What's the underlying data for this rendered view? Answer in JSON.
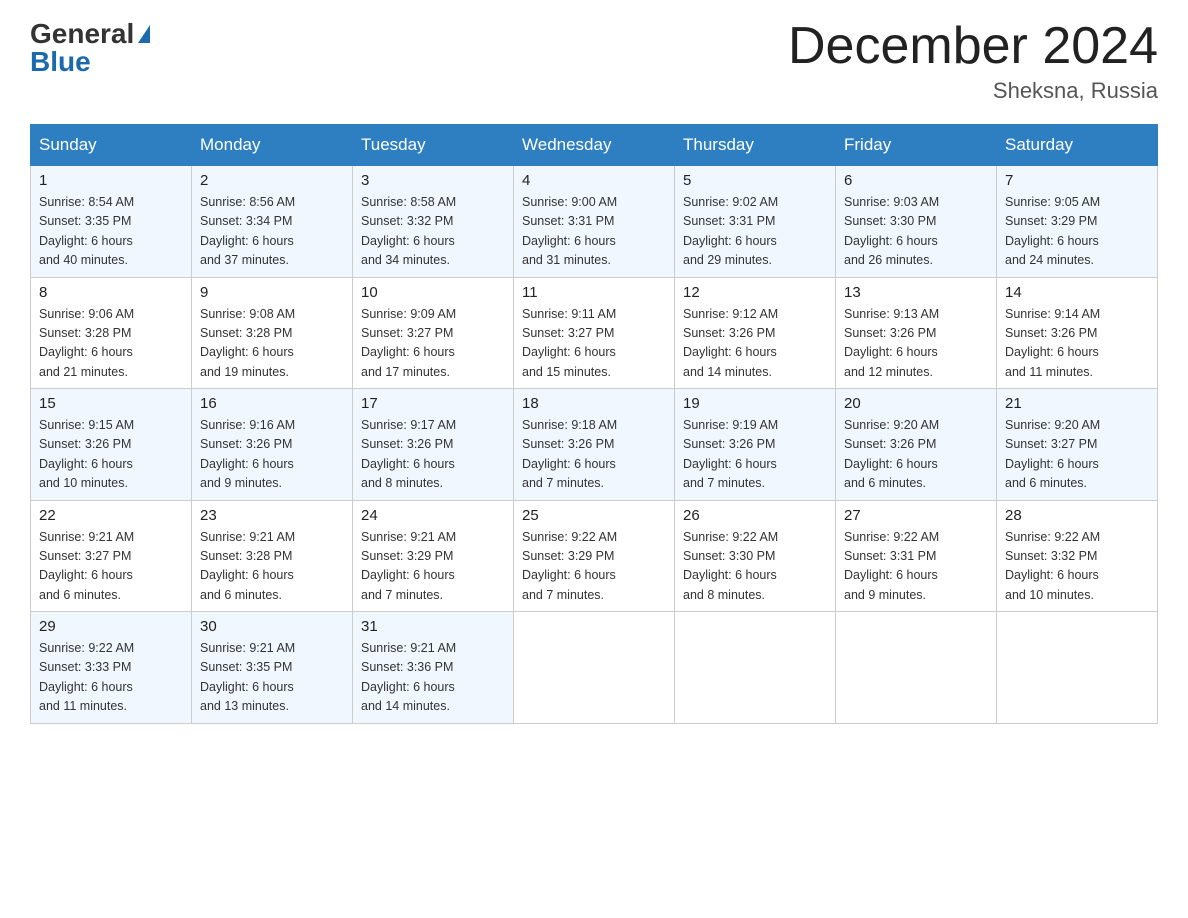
{
  "header": {
    "logo_general": "General",
    "logo_blue": "Blue",
    "month_title": "December 2024",
    "location": "Sheksna, Russia"
  },
  "calendar": {
    "days_of_week": [
      "Sunday",
      "Monday",
      "Tuesday",
      "Wednesday",
      "Thursday",
      "Friday",
      "Saturday"
    ],
    "weeks": [
      [
        {
          "day": "1",
          "info": "Sunrise: 8:54 AM\nSunset: 3:35 PM\nDaylight: 6 hours\nand 40 minutes."
        },
        {
          "day": "2",
          "info": "Sunrise: 8:56 AM\nSunset: 3:34 PM\nDaylight: 6 hours\nand 37 minutes."
        },
        {
          "day": "3",
          "info": "Sunrise: 8:58 AM\nSunset: 3:32 PM\nDaylight: 6 hours\nand 34 minutes."
        },
        {
          "day": "4",
          "info": "Sunrise: 9:00 AM\nSunset: 3:31 PM\nDaylight: 6 hours\nand 31 minutes."
        },
        {
          "day": "5",
          "info": "Sunrise: 9:02 AM\nSunset: 3:31 PM\nDaylight: 6 hours\nand 29 minutes."
        },
        {
          "day": "6",
          "info": "Sunrise: 9:03 AM\nSunset: 3:30 PM\nDaylight: 6 hours\nand 26 minutes."
        },
        {
          "day": "7",
          "info": "Sunrise: 9:05 AM\nSunset: 3:29 PM\nDaylight: 6 hours\nand 24 minutes."
        }
      ],
      [
        {
          "day": "8",
          "info": "Sunrise: 9:06 AM\nSunset: 3:28 PM\nDaylight: 6 hours\nand 21 minutes."
        },
        {
          "day": "9",
          "info": "Sunrise: 9:08 AM\nSunset: 3:28 PM\nDaylight: 6 hours\nand 19 minutes."
        },
        {
          "day": "10",
          "info": "Sunrise: 9:09 AM\nSunset: 3:27 PM\nDaylight: 6 hours\nand 17 minutes."
        },
        {
          "day": "11",
          "info": "Sunrise: 9:11 AM\nSunset: 3:27 PM\nDaylight: 6 hours\nand 15 minutes."
        },
        {
          "day": "12",
          "info": "Sunrise: 9:12 AM\nSunset: 3:26 PM\nDaylight: 6 hours\nand 14 minutes."
        },
        {
          "day": "13",
          "info": "Sunrise: 9:13 AM\nSunset: 3:26 PM\nDaylight: 6 hours\nand 12 minutes."
        },
        {
          "day": "14",
          "info": "Sunrise: 9:14 AM\nSunset: 3:26 PM\nDaylight: 6 hours\nand 11 minutes."
        }
      ],
      [
        {
          "day": "15",
          "info": "Sunrise: 9:15 AM\nSunset: 3:26 PM\nDaylight: 6 hours\nand 10 minutes."
        },
        {
          "day": "16",
          "info": "Sunrise: 9:16 AM\nSunset: 3:26 PM\nDaylight: 6 hours\nand 9 minutes."
        },
        {
          "day": "17",
          "info": "Sunrise: 9:17 AM\nSunset: 3:26 PM\nDaylight: 6 hours\nand 8 minutes."
        },
        {
          "day": "18",
          "info": "Sunrise: 9:18 AM\nSunset: 3:26 PM\nDaylight: 6 hours\nand 7 minutes."
        },
        {
          "day": "19",
          "info": "Sunrise: 9:19 AM\nSunset: 3:26 PM\nDaylight: 6 hours\nand 7 minutes."
        },
        {
          "day": "20",
          "info": "Sunrise: 9:20 AM\nSunset: 3:26 PM\nDaylight: 6 hours\nand 6 minutes."
        },
        {
          "day": "21",
          "info": "Sunrise: 9:20 AM\nSunset: 3:27 PM\nDaylight: 6 hours\nand 6 minutes."
        }
      ],
      [
        {
          "day": "22",
          "info": "Sunrise: 9:21 AM\nSunset: 3:27 PM\nDaylight: 6 hours\nand 6 minutes."
        },
        {
          "day": "23",
          "info": "Sunrise: 9:21 AM\nSunset: 3:28 PM\nDaylight: 6 hours\nand 6 minutes."
        },
        {
          "day": "24",
          "info": "Sunrise: 9:21 AM\nSunset: 3:29 PM\nDaylight: 6 hours\nand 7 minutes."
        },
        {
          "day": "25",
          "info": "Sunrise: 9:22 AM\nSunset: 3:29 PM\nDaylight: 6 hours\nand 7 minutes."
        },
        {
          "day": "26",
          "info": "Sunrise: 9:22 AM\nSunset: 3:30 PM\nDaylight: 6 hours\nand 8 minutes."
        },
        {
          "day": "27",
          "info": "Sunrise: 9:22 AM\nSunset: 3:31 PM\nDaylight: 6 hours\nand 9 minutes."
        },
        {
          "day": "28",
          "info": "Sunrise: 9:22 AM\nSunset: 3:32 PM\nDaylight: 6 hours\nand 10 minutes."
        }
      ],
      [
        {
          "day": "29",
          "info": "Sunrise: 9:22 AM\nSunset: 3:33 PM\nDaylight: 6 hours\nand 11 minutes."
        },
        {
          "day": "30",
          "info": "Sunrise: 9:21 AM\nSunset: 3:35 PM\nDaylight: 6 hours\nand 13 minutes."
        },
        {
          "day": "31",
          "info": "Sunrise: 9:21 AM\nSunset: 3:36 PM\nDaylight: 6 hours\nand 14 minutes."
        },
        {
          "day": "",
          "info": ""
        },
        {
          "day": "",
          "info": ""
        },
        {
          "day": "",
          "info": ""
        },
        {
          "day": "",
          "info": ""
        }
      ]
    ]
  }
}
